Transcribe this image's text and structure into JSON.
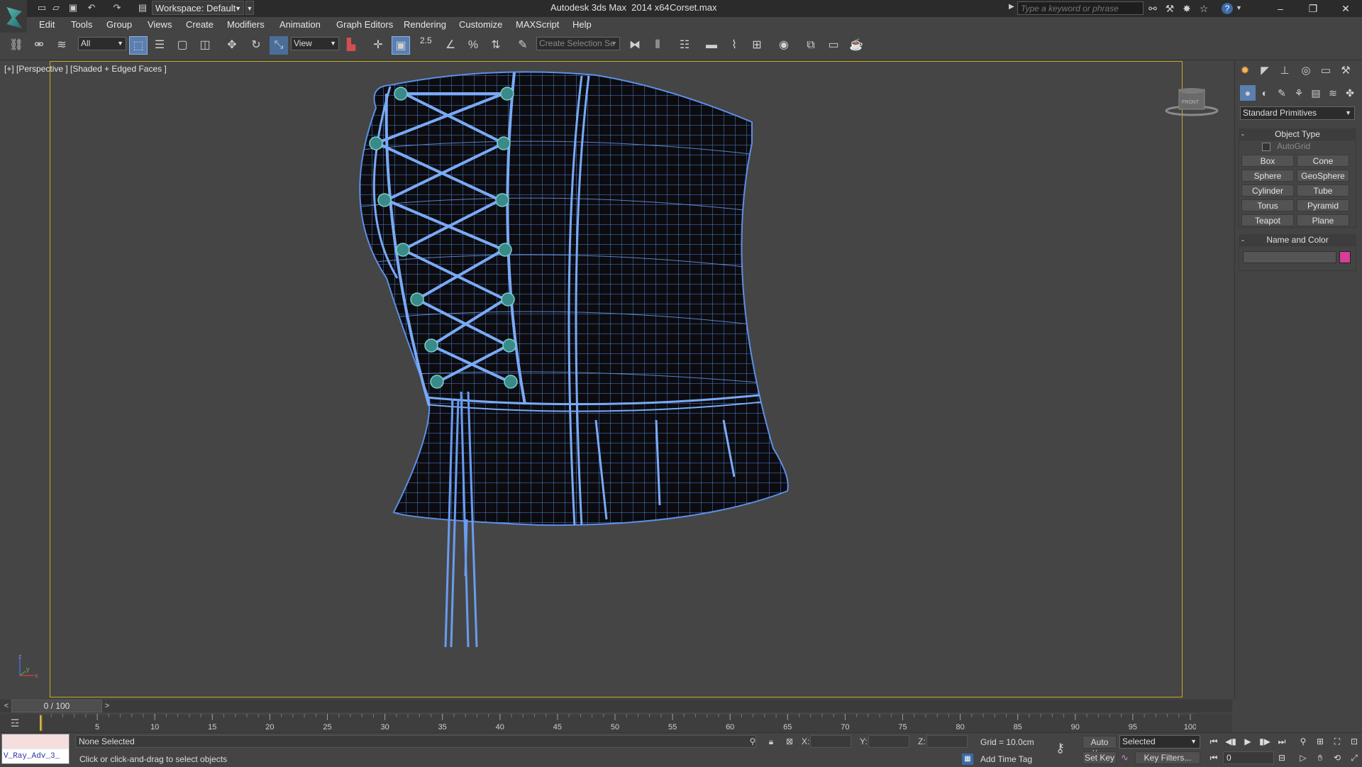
{
  "title_bar": {
    "workspace_label": "Workspace: Default",
    "app_title": "Autodesk 3ds Max  2014 x64",
    "file_name": "Corset.max",
    "search_placeholder": "Type a keyword or phrase",
    "quick_access_icons": [
      "new-icon",
      "open-icon",
      "save-icon",
      "undo-icon",
      "redo-icon",
      "project-folder-icon"
    ],
    "help_icons": [
      "binoculars-icon",
      "search-tools-icon",
      "star-icon",
      "help-icon"
    ]
  },
  "menu": {
    "items": [
      "Edit",
      "Tools",
      "Group",
      "Views",
      "Create",
      "Modifiers",
      "Animation",
      "Graph Editors",
      "Rendering",
      "Customize",
      "MAXScript",
      "Help"
    ]
  },
  "toolbar": {
    "selection_filter": "All",
    "reference_coord": "View",
    "snap_label": "2.5",
    "selection_set_placeholder": "Create Selection Se"
  },
  "viewport": {
    "label": "[+] [Perspective ] [Shaded + Edged Faces ]",
    "viewcube_label": "FRONT",
    "axis": {
      "x": "x",
      "y": "y",
      "z": "z"
    }
  },
  "command_panel": {
    "category": "Standard Primitives",
    "object_type": {
      "title": "Object Type",
      "autogrid": "AutoGrid",
      "buttons": [
        "Box",
        "Cone",
        "Sphere",
        "GeoSphere",
        "Cylinder",
        "Tube",
        "Torus",
        "Pyramid",
        "Teapot",
        "Plane"
      ]
    },
    "name_and_color": {
      "title": "Name and Color",
      "name_value": "",
      "color": "#d63f95"
    }
  },
  "timeline": {
    "slider_label": "0 / 100",
    "ticks": [
      5,
      10,
      15,
      20,
      25,
      30,
      35,
      40,
      45,
      50,
      55,
      60,
      65,
      70,
      75,
      80,
      85,
      90,
      95,
      100
    ],
    "range": [
      0,
      100
    ],
    "current_frame": 0
  },
  "status": {
    "listener_text": "V_Ray_Adv_3_",
    "selection": "None Selected",
    "prompt": "Click or click-and-drag to select objects",
    "x_label": "X:",
    "y_label": "Y:",
    "z_label": "Z:",
    "x_value": "",
    "y_value": "",
    "z_value": "",
    "grid": "Grid = 10.0cm",
    "add_time_tag": "Add Time Tag",
    "auto_key": "Auto Key",
    "set_key": "Set Key",
    "key_mode": "Selected",
    "key_filters": "Key Filters...",
    "frame_value": "0"
  },
  "colors": {
    "wire": "#5d8fe8",
    "viewport_border": "#c8a828",
    "bg": "#454545"
  }
}
